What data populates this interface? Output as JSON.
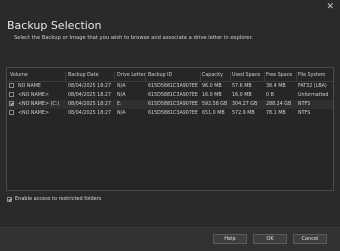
{
  "window": {
    "title": "Backup Selection",
    "close_glyph": "✕",
    "subtitle": "Select the Backup or Image that you wish to browse and associate a drive letter in explorer."
  },
  "table": {
    "columns": [
      "Volume",
      "Backup Date",
      "Drive Letter",
      "Backup ID",
      "Capacity",
      "Used Space",
      "Free Space",
      "File System"
    ],
    "rows": [
      {
        "checked": false,
        "volume": "NO NAME",
        "date": "08/04/2025 18:27",
        "drive": "N/A",
        "id": "615D5881C3A907EE",
        "capacity": "96.0 MB",
        "used": "57.6 MB",
        "free": "38.4 MB",
        "fs": "FAT32 (LBA)"
      },
      {
        "checked": false,
        "volume": "<NO NAME>",
        "date": "08/04/2025 18:27",
        "drive": "N/A",
        "id": "615D5881C3A907EE",
        "capacity": "16.0 MB",
        "used": "16.0 MB",
        "free": "0 B",
        "fs": "Unformatted"
      },
      {
        "checked": true,
        "volume": "<NO NAME> (C:)",
        "date": "08/04/2025 18:27",
        "drive": "E:",
        "id": "615D5881C3A907EE",
        "capacity": "592.58 GB",
        "used": "304.27 GB",
        "free": "288.24 GB",
        "fs": "NTFS"
      },
      {
        "checked": false,
        "volume": "<NO NAME>",
        "date": "08/04/2025 18:27",
        "drive": "N/A",
        "id": "615D5881C3A907EE",
        "capacity": "651.0 MB",
        "used": "572.9 MB",
        "free": "78.1 MB",
        "fs": "NTFS"
      }
    ]
  },
  "options": {
    "restricted_checked": true,
    "restricted_label": "Enable access to restricted folders"
  },
  "buttons": {
    "help": "Help",
    "ok": "OK",
    "cancel": "Cancel"
  }
}
